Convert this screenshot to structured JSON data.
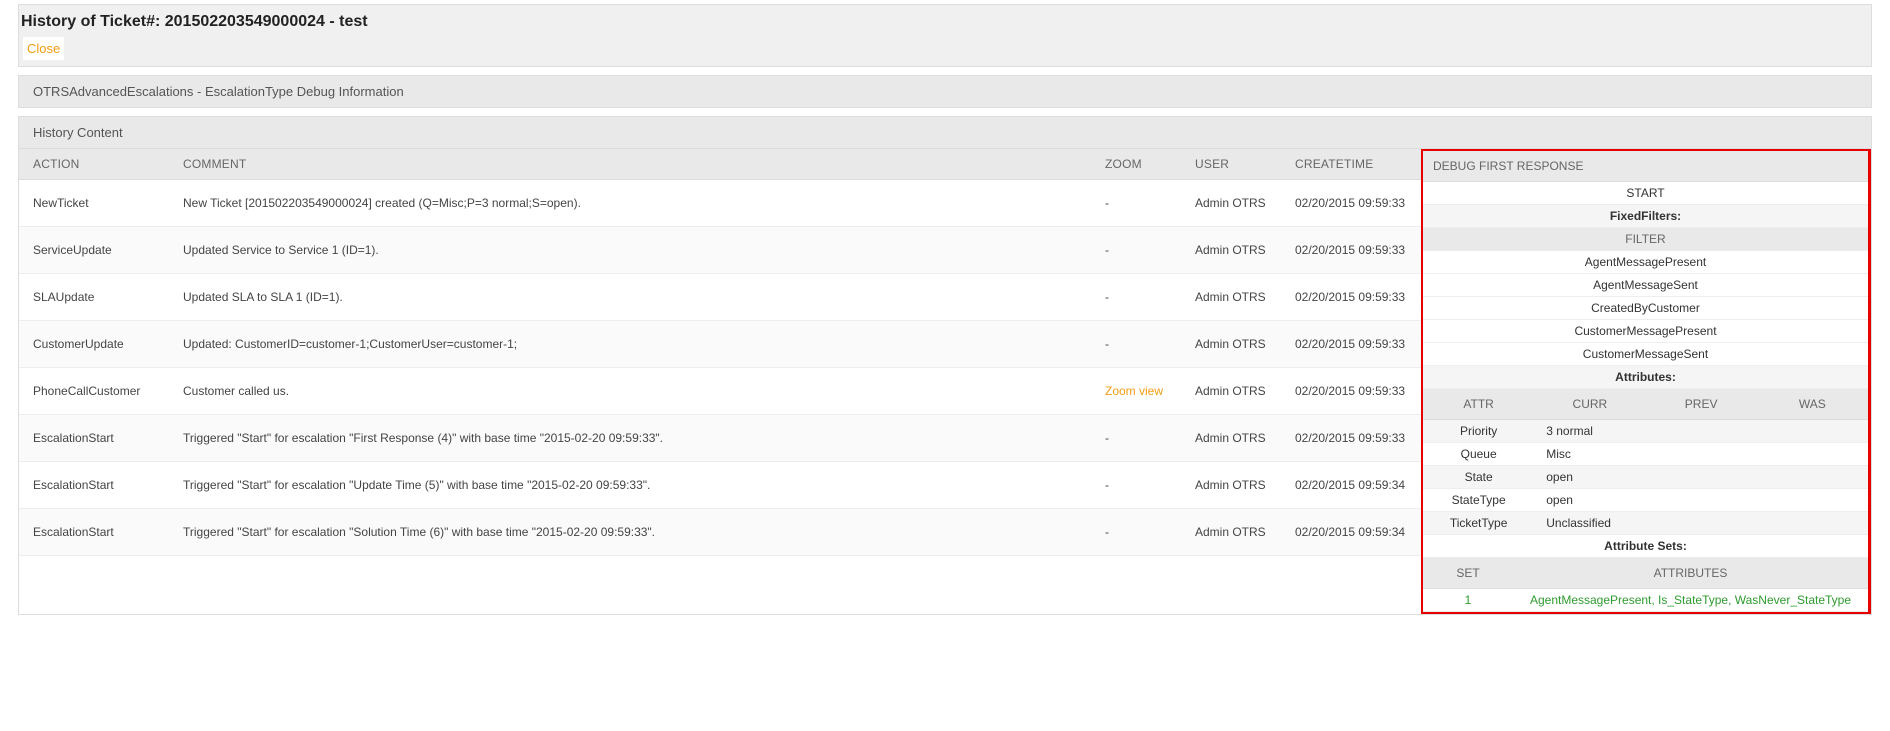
{
  "header": {
    "title": "History of Ticket#: 201502203549000024 - test",
    "close": "Close"
  },
  "section_bar": "OTRSAdvancedEscalations - EscalationType Debug Information",
  "content_header": "History Content",
  "history": {
    "columns": {
      "action": "ACTION",
      "comment": "COMMENT",
      "zoom": "ZOOM",
      "user": "USER",
      "createtime": "CREATETIME"
    },
    "rows": [
      {
        "action": "NewTicket",
        "comment": "New Ticket [201502203549000024] created (Q=Misc;P=3 normal;S=open).",
        "zoom": "-",
        "zoom_link": false,
        "user": "Admin OTRS",
        "createtime": "02/20/2015 09:59:33"
      },
      {
        "action": "ServiceUpdate",
        "comment": "Updated Service to Service 1 (ID=1).",
        "zoom": "-",
        "zoom_link": false,
        "user": "Admin OTRS",
        "createtime": "02/20/2015 09:59:33"
      },
      {
        "action": "SLAUpdate",
        "comment": "Updated SLA to SLA 1 (ID=1).",
        "zoom": "-",
        "zoom_link": false,
        "user": "Admin OTRS",
        "createtime": "02/20/2015 09:59:33"
      },
      {
        "action": "CustomerUpdate",
        "comment": "Updated: CustomerID=customer-1;CustomerUser=customer-1;",
        "zoom": "-",
        "zoom_link": false,
        "user": "Admin OTRS",
        "createtime": "02/20/2015 09:59:33"
      },
      {
        "action": "PhoneCallCustomer",
        "comment": "Customer called us.",
        "zoom": "Zoom view",
        "zoom_link": true,
        "user": "Admin OTRS",
        "createtime": "02/20/2015 09:59:33"
      },
      {
        "action": "EscalationStart",
        "comment": "Triggered \"Start\" for escalation \"First Response (4)\" with base time \"2015-02-20 09:59:33\".",
        "zoom": "-",
        "zoom_link": false,
        "user": "Admin OTRS",
        "createtime": "02/20/2015 09:59:33"
      },
      {
        "action": "EscalationStart",
        "comment": "Triggered \"Start\" for escalation \"Update Time (5)\" with base time \"2015-02-20 09:59:33\".",
        "zoom": "-",
        "zoom_link": false,
        "user": "Admin OTRS",
        "createtime": "02/20/2015 09:59:34"
      },
      {
        "action": "EscalationStart",
        "comment": "Triggered \"Start\" for escalation \"Solution Time (6)\" with base time \"2015-02-20 09:59:33\".",
        "zoom": "-",
        "zoom_link": false,
        "user": "Admin OTRS",
        "createtime": "02/20/2015 09:59:34"
      }
    ]
  },
  "debug": {
    "header": "DEBUG FIRST RESPONSE",
    "start": "START",
    "fixed_filters_label": "FixedFilters:",
    "filter_label": "FILTER",
    "filters": [
      {
        "name": "AgentMessagePresent",
        "pass": false
      },
      {
        "name": "AgentMessageSent",
        "pass": false
      },
      {
        "name": "CreatedByCustomer",
        "pass": true
      },
      {
        "name": "CustomerMessagePresent",
        "pass": true
      },
      {
        "name": "CustomerMessageSent",
        "pass": true
      }
    ],
    "attributes_label": "Attributes:",
    "attr_headers": {
      "attr": "ATTR",
      "curr": "CURR",
      "prev": "PREV",
      "was": "WAS"
    },
    "attrs": [
      {
        "attr": "Priority",
        "curr": "3 normal",
        "prev": "",
        "was": ""
      },
      {
        "attr": "Queue",
        "curr": "Misc",
        "prev": "",
        "was": ""
      },
      {
        "attr": "State",
        "curr": "open",
        "prev": "",
        "was": ""
      },
      {
        "attr": "StateType",
        "curr": "open",
        "prev": "",
        "was": ""
      },
      {
        "attr": "TicketType",
        "curr": "Unclassified",
        "prev": "",
        "was": ""
      }
    ],
    "attribute_sets_label": "Attribute Sets:",
    "set_headers": {
      "set": "SET",
      "attributes": "ATTRIBUTES"
    },
    "sets": [
      {
        "set": "1",
        "attributes": "AgentMessagePresent, Is_StateType, WasNever_StateType"
      }
    ]
  }
}
